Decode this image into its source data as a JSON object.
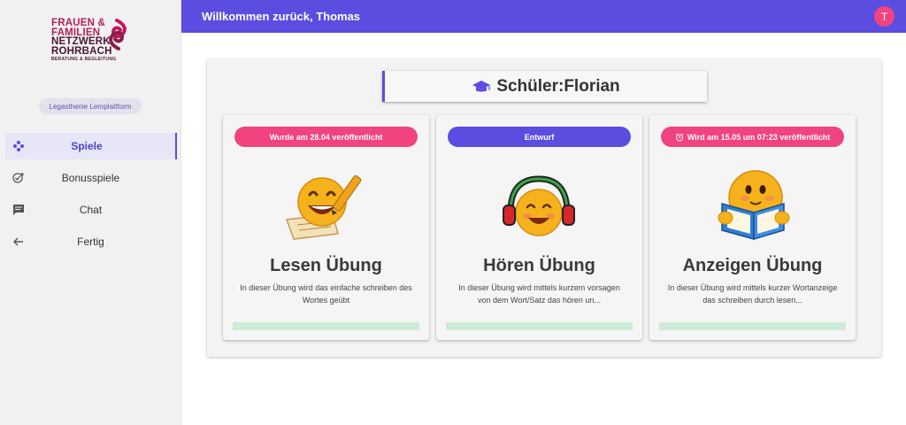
{
  "sidebar": {
    "logo": {
      "line1": "FRAUEN &",
      "line2": "FAMILIEN",
      "line3": "NETZWERK",
      "line4": "ROHRBACH",
      "sub": "BERATUNG & BEGLEITUNG"
    },
    "platform_label": "Legasthenie Lernplattform",
    "items": [
      {
        "label": "Spiele",
        "icon": "gamepad-icon",
        "active": true
      },
      {
        "label": "Bonusspiele",
        "icon": "check-plus-icon",
        "active": false
      },
      {
        "label": "Chat",
        "icon": "chat-icon",
        "active": false
      },
      {
        "label": "Fertig",
        "icon": "arrow-left-icon",
        "active": false
      }
    ]
  },
  "header": {
    "welcome": "Willkommen zurück, Thomas",
    "avatar_initial": "T"
  },
  "main": {
    "student_title": "Schüler:Florian",
    "cards": [
      {
        "badge": "Wurde am 28.04 veröffentlicht",
        "badge_color": "#f0437f",
        "emoji": "writing-emoji",
        "title": "Lesen Übung",
        "description": "In dieser Übung wird das einfache schreiben des Wortes geübt"
      },
      {
        "badge": "Entwurf",
        "badge_color": "#5b4de0",
        "emoji": "headphones-emoji",
        "title": "Hören Übung",
        "description": "In dieser Übung wird mittels kurzem vorsagen von dem Wort/Satz das hören un..."
      },
      {
        "badge": "Wird am 15.05 um 07:23 veröffentlicht",
        "badge_color": "#f0437f",
        "badge_icon": "alarm-icon",
        "emoji": "reading-emoji",
        "title": "Anzeigen Übung",
        "description": "In dieser Übung wird mittels kurzer Wortanzeige das schreiben durch lesen..."
      }
    ]
  },
  "colors": {
    "primary": "#5b4de0",
    "accent": "#f0437f",
    "progress": "#cdebd6"
  }
}
